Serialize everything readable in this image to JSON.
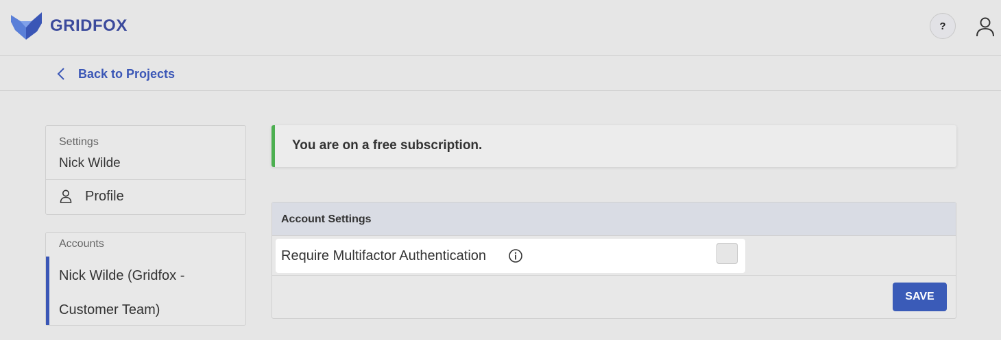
{
  "header": {
    "brand": "GRIDFOX",
    "help_label": "?",
    "brand_color": "#3b4a9c"
  },
  "nav": {
    "back_label": "Back to Projects"
  },
  "sidebar": {
    "settings_caption": "Settings",
    "user_name": "Nick Wilde",
    "profile_label": "Profile",
    "accounts_caption": "Accounts",
    "account_name": "Nick Wilde (Gridfox - Customer Team)"
  },
  "banner": {
    "message": "You are on a free subscription.",
    "accent_color": "#4caf50"
  },
  "account_settings": {
    "title": "Account Settings",
    "mfa_label": "Require Multifactor Authentication",
    "mfa_checked": false,
    "save_label": "SAVE",
    "accent_color": "#3a5bb8"
  },
  "icons": {
    "logo": "fox-logo-icon",
    "help": "help-icon",
    "user": "user-icon",
    "back": "chevron-left-icon",
    "profile": "person-icon",
    "info": "info-icon"
  }
}
